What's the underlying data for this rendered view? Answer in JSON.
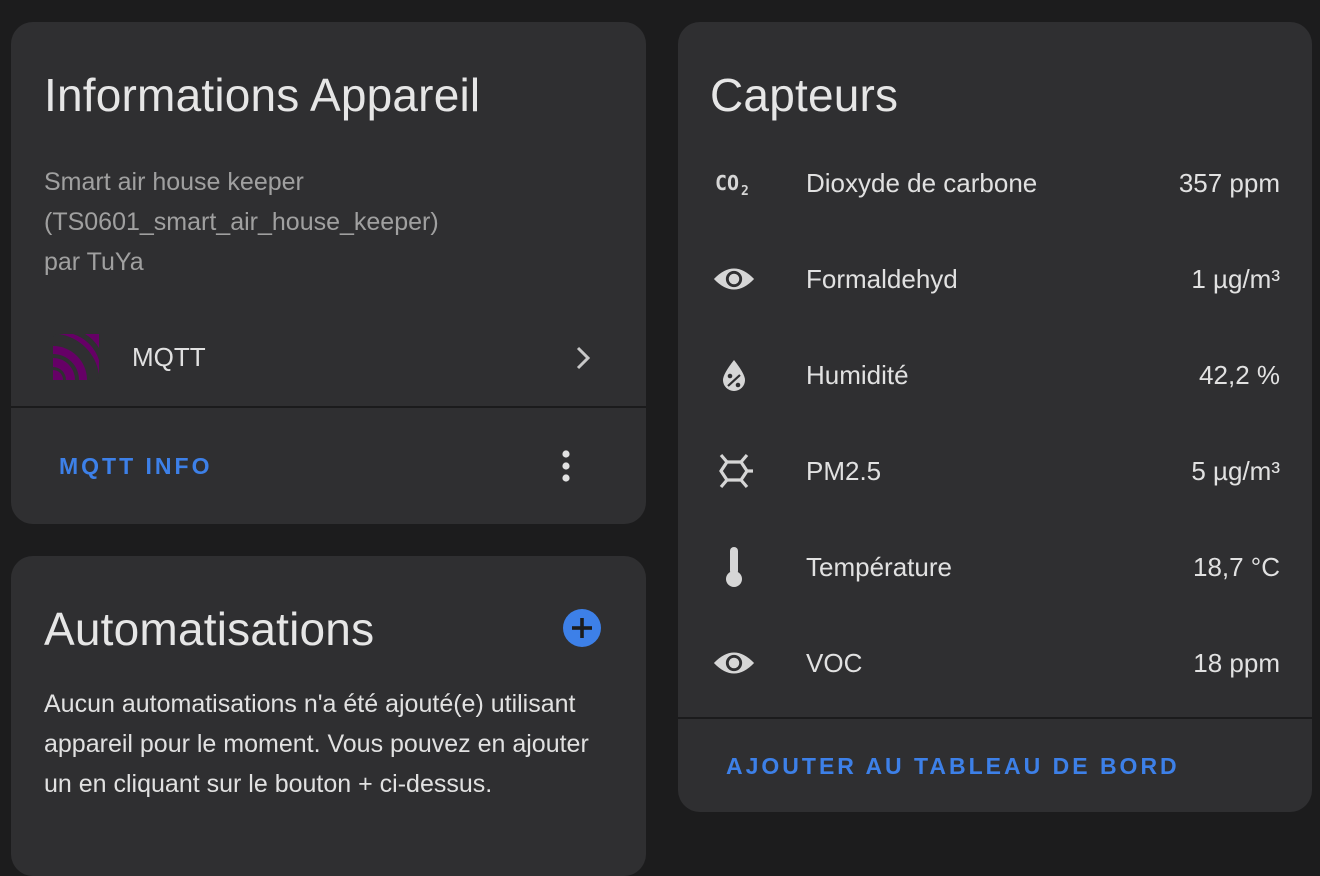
{
  "device_info": {
    "title": "Informations Appareil",
    "model_line": "Smart air house keeper",
    "model_id_line": "(TS0601_smart_air_house_keeper)",
    "manufacturer_line": "par TuYa",
    "integration": {
      "label": "MQTT",
      "icon": "mqtt-icon"
    },
    "action_label": "MQTT INFO",
    "overflow_icon": "dots-vertical-icon"
  },
  "automations": {
    "title": "Automatisations",
    "add_icon": "plus-circle-icon",
    "empty_text": "Aucun automatisations n'a été ajouté(e) utilisant appareil pour le moment. Vous pouvez en ajouter un en cliquant sur le bouton + ci-dessus."
  },
  "sensors": {
    "title": "Capteurs",
    "items": [
      {
        "name": "Dioxyde de carbone",
        "value": "357 ppm",
        "icon": "co2-icon"
      },
      {
        "name": "Formaldehyd",
        "value": "1 µg/m³",
        "icon": "eye-icon"
      },
      {
        "name": "Humidité",
        "value": "42,2 %",
        "icon": "water-percent-icon"
      },
      {
        "name": "PM2.5",
        "value": "5 µg/m³",
        "icon": "molecule-icon"
      },
      {
        "name": "Température",
        "value": "18,7 °C",
        "icon": "thermometer-icon"
      },
      {
        "name": "VOC",
        "value": "18 ppm",
        "icon": "eye-icon"
      }
    ],
    "action_label": "AJOUTER AU TABLEAU DE BORD"
  },
  "colors": {
    "background": "#1c1c1d",
    "card": "#2f2f31",
    "accent": "#3d80e8",
    "mqtt_brand": "#660066"
  }
}
